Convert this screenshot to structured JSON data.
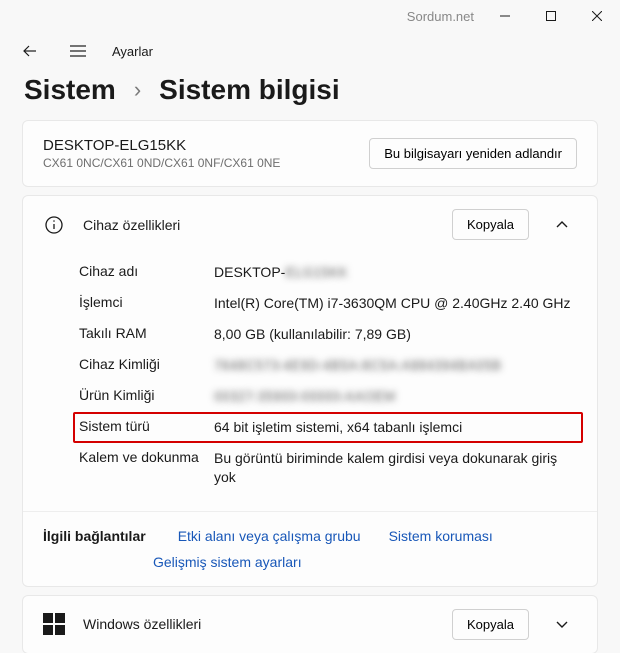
{
  "titlebar_brand": "Sordum.net",
  "app_name": "Ayarlar",
  "crumb_root": "Sistem",
  "crumb_sep": "›",
  "crumb_page": "Sistem bilgisi",
  "device": {
    "name": "DESKTOP-ELG15KK",
    "model": "CX61 0NC/CX61 0ND/CX61 0NF/CX61 0NE",
    "rename_btn": "Bu bilgisayarı yeniden adlandır"
  },
  "device_props": {
    "title": "Cihaz özellikleri",
    "copy_btn": "Kopyala",
    "rows": {
      "device_name": {
        "label": "Cihaz adı",
        "value": "DESKTOP-████████"
      },
      "processor": {
        "label": "İşlemci",
        "value": "Intel(R) Core(TM) i7-3630QM CPU @ 2.40GHz   2.40 GHz"
      },
      "ram": {
        "label": "Takılı RAM",
        "value": "8,00 GB (kullanılabilir: 7,89 GB)"
      },
      "device_id": {
        "label": "Cihaz Kimliği",
        "value": "████████-████-████-████-████████████"
      },
      "product_id": {
        "label": "Ürün Kimliği",
        "value": "█████-█████-█████-█████"
      },
      "system_type": {
        "label": "Sistem türü",
        "value": "64 bit işletim sistemi, x64 tabanlı işlemci"
      },
      "pen_touch": {
        "label": "Kalem ve dokunma",
        "value": "Bu görüntü biriminde kalem girdisi veya dokunarak giriş yok"
      }
    }
  },
  "related_links": {
    "label": "İlgili bağlantılar",
    "items": [
      "Etki alanı veya çalışma grubu",
      "Sistem koruması",
      "Gelişmiş sistem ayarları"
    ]
  },
  "win_features": {
    "title": "Windows özellikleri",
    "copy_btn": "Kopyala"
  }
}
